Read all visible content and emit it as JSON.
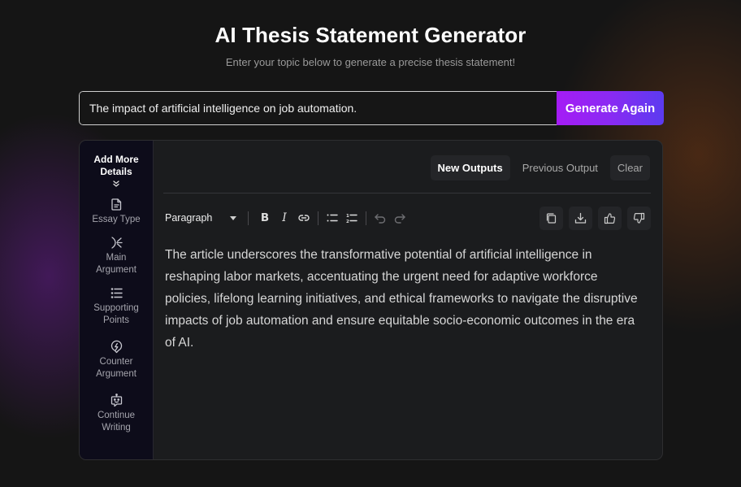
{
  "header": {
    "title": "AI Thesis Statement Generator",
    "subtitle": "Enter your topic below to generate a precise thesis statement!"
  },
  "topic": {
    "value": "The impact of artificial intelligence on job automation.",
    "generate_label": "Generate Again"
  },
  "sidebar": {
    "heading": "Add More Details",
    "heading_icon": "chevrons-down-icon",
    "items": [
      {
        "label": "Essay Type",
        "icon": "document-icon"
      },
      {
        "label": "Main Argument",
        "icon": "argument-branch-icon"
      },
      {
        "label": "Supporting Points",
        "icon": "list-icon"
      },
      {
        "label": "Counter Argument",
        "icon": "lightning-bubble-icon"
      },
      {
        "label": "Continue Writing",
        "icon": "robot-icon"
      }
    ]
  },
  "tabs": [
    {
      "label": "New Outputs",
      "active": true
    },
    {
      "label": "Previous Output",
      "active": false
    },
    {
      "label": "Clear",
      "active": false
    }
  ],
  "toolbar": {
    "block_format": "Paragraph",
    "bold": "B",
    "italic": "I",
    "buttons": [
      "bold-icon",
      "italic-icon",
      "link-icon",
      "bullet-list-icon",
      "numbered-list-icon",
      "undo-icon",
      "redo-icon"
    ],
    "actions": [
      "copy-icon",
      "download-icon",
      "thumbs-up-icon",
      "thumbs-down-icon"
    ]
  },
  "output": {
    "text": "The article underscores the transformative potential of artificial intelligence in reshaping labor markets, accentuating the urgent need for adaptive workforce policies, lifelong learning initiatives, and ethical frameworks to navigate the disruptive impacts of job automation and ensure equitable socio-economic outcomes in the era of AI."
  },
  "colors": {
    "accent_start": "#a51cf5",
    "accent_end": "#5b3bf0",
    "background": "#151515",
    "panel": "#1b1c1e",
    "sidebar": "#0d0c1a"
  }
}
